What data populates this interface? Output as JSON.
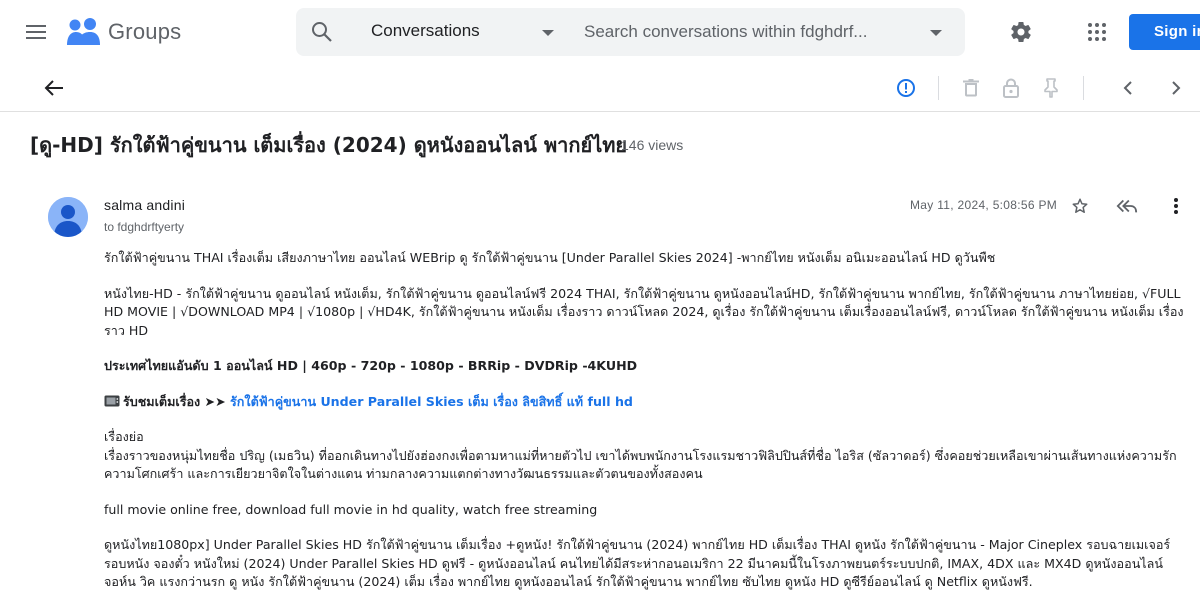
{
  "app": {
    "name": "Groups",
    "search_scope": "Conversations",
    "search_placeholder": "Search conversations within fdghdrf...",
    "sign_in_label": "Sign in"
  },
  "icons": {
    "menu": "hamburger-menu-icon",
    "logo": "groups-people-icon",
    "search": "magnifier-icon",
    "settings": "gear-icon",
    "apps": "grid-apps-icon",
    "back": "arrow-left-icon",
    "info": "info-circle-icon",
    "delete": "trash-icon",
    "lock": "lock-icon",
    "pin": "pin-icon",
    "prev": "chevron-left-icon",
    "next": "chevron-right-icon",
    "star": "star-outline-icon",
    "reply_all": "reply-all-icon",
    "more": "more-vertical-icon"
  },
  "colors": {
    "accent": "#1a73e8",
    "logo_blue": "#4285f4",
    "avatar": "#8ab4f8"
  },
  "thread": {
    "title": "[ดู-HD] รักใต้ฟ้าคู่ขนาน เต็มเรื่อง (2024) ดูหนังออนไลน์ พากย์ไทย",
    "views": "146 views"
  },
  "message": {
    "author": "salma andini",
    "recipient": "to fdghdrftyerty",
    "date": "May 11, 2024, 5:08:56 PM",
    "p1": "รักใต้ฟ้าคู่ขนาน THAI เรื่องเต็ม เสียงภาษาไทย ออนไลน์ WEBrip ดู รักใต้ฟ้าคู่ขนาน [Under Parallel Skies 2024] -พากย์ไทย หนังเต็ม อนิเมะออนไลน์ HD ดูวันพืช",
    "p2": "หนังไทย-HD - รักใต้ฟ้าคู่ขนาน ดูออนไลน์ หนังเต็ม, รักใต้ฟ้าคู่ขนาน ดูออนไลน์ฟรี 2024 THAI, รักใต้ฟ้าคู่ขนาน ดูหนังออนไลน์HD, รักใต้ฟ้าคู่ขนาน พากย์ไทย, รักใต้ฟ้าคู่ขนาน ภาษาไทยย่อย, √FULL HD MOVIE | √DOWNLOAD MP4 | √1080p | √HD4K, รักใต้ฟ้าคู่ขนาน หนังเต็ม เรื่องราว ดาวน์โหลด 2024, ดูเรื่อง รักใต้ฟ้าคู่ขนาน เต็มเรื่องออนไลน์ฟรี, ดาวน์โหลด รักใต้ฟ้าคู่ขนาน หนังเต็ม เรื่องราว HD",
    "p3": "ประเทศไทยแอันดับ 1 ออนไลน์ HD | 460p - 720p - 1080p - BRRip - DVDRip -4KUHD",
    "p4_prefix": "รับชมเต็มเรื่อง ➤➤ ",
    "p4_link": "รักใต้ฟ้าคู่ขนาน Under Parallel Skies เต็ม เรื่อง ลิขสิทธิ์ แท้ full hd",
    "p5_heading": "เรื่องย่อ",
    "p5": "เรื่องราวของหนุ่มไทยชื่อ ปริญ (เมธวิน) ที่ออกเดินทางไปยังฮ่องกงเพื่อตามหาแม่ที่หายตัวไป เขาได้พบพนักงานโรงแรมชาวฟิลิปปินส์ที่ชื่อ ไอริส (ซัลวาดอร์) ซึ่งคอยช่วยเหลือเขาผ่านเส้นทางแห่งความรัก ความโศกเศร้า และการเยียวยาจิตใจในต่างแดน ท่ามกลางความแตกต่างทางวัฒนธรรมและตัวตนของทั้งสองคน",
    "p6": "full movie online free, download full movie in hd quality, watch free streaming",
    "p7": "ดูหนังไทย1080px] Under Parallel Skies HD รักใต้ฟ้าคู่ขนาน เต็มเรื่อง +ดูหนัง! รักใต้ฟ้าคู่ขนาน (2024) พากย์ไทย HD เต็มเรื่อง THAI ดูหนัง รักใต้ฟ้าคู่ขนาน - Major Cineplex รอบฉายเมเจอร์ รอบหนัง จองตั๋ว หนังใหม่ (2024) Under Parallel Skies HD ดูฟรี - ดูหนังออนไลน์ คนไทยได้มีสระห่ากอนอเมริกา 22 มีนาคมนี้ในโรงภาพยนตร์ระบบปกติ, IMAX, 4DX และ MX4D ดูหนังออนไลน์ จอห์น วิค แรงกว่านรก ดู หนัง รักใต้ฟ้าคู่ขนาน (2024) เต็ม เรื่อง พากย์ไทย ดูหนังออนไลน์ รักใต้ฟ้าคู่ขนาน พากย์ไทย ซับไทย ดูหนัง HD ดูซีรีย์ออนไลน์ ดู Netflix ดูหนังฟรี."
  }
}
